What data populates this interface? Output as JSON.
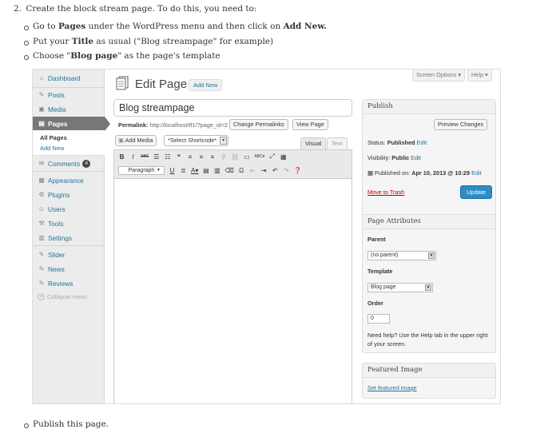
{
  "doc": {
    "step_number": "2.",
    "step_text": "Create the block stream page. To do this, you need to:",
    "bullets": [
      {
        "pre": "Go to ",
        "bold1": "Pages",
        "mid": " under the WordPress menu and then click on ",
        "bold2": "Add New.",
        "post": ""
      },
      {
        "pre": "Put your ",
        "bold1": "Title",
        "mid": " as usual (\"Blog streampage\" for example)",
        "bold2": "",
        "post": ""
      },
      {
        "pre": "Choose \"",
        "bold1": "Blog page",
        "mid": "\" as the page's template",
        "bold2": "",
        "post": ""
      }
    ],
    "final_bullet": "Publish this page."
  },
  "admin_menu": {
    "items": [
      {
        "label": "Dashboard",
        "icon": "dashboard-icon",
        "glyph": "⌂"
      },
      {
        "label": "Posts",
        "icon": "pin-icon",
        "glyph": "✎"
      },
      {
        "label": "Media",
        "icon": "media-icon",
        "glyph": "▣"
      },
      {
        "label": "Pages",
        "icon": "pages-icon",
        "glyph": "▤"
      },
      {
        "label": "Comments",
        "icon": "comments-icon",
        "glyph": "✉",
        "badge": "4"
      },
      {
        "label": "Appearance",
        "icon": "appearance-icon",
        "glyph": "▦"
      },
      {
        "label": "Plugins",
        "icon": "plugins-icon",
        "glyph": "⚙"
      },
      {
        "label": "Users",
        "icon": "users-icon",
        "glyph": "☺"
      },
      {
        "label": "Tools",
        "icon": "tools-icon",
        "glyph": "⚒"
      },
      {
        "label": "Settings",
        "icon": "settings-icon",
        "glyph": "▥"
      },
      {
        "label": "Slider",
        "icon": "pin-icon",
        "glyph": "✎"
      },
      {
        "label": "News",
        "icon": "pin-icon",
        "glyph": "✎"
      },
      {
        "label": "Reviews",
        "icon": "pin-icon",
        "glyph": "✎"
      }
    ],
    "submenu": {
      "all_pages": "All Pages",
      "add_new": "Add New"
    },
    "collapse": "Collapse menu"
  },
  "top_tabs": {
    "screen_options": "Screen Options ▾",
    "help": "Help ▾"
  },
  "header": {
    "title": "Edit Page",
    "add_new": "Add New"
  },
  "title_field": {
    "value": "Blog streampage"
  },
  "permalink": {
    "label": "Permalink:",
    "url": "http://localhost/tf1/?page_id=2",
    "change_btn": "Change Permalinks",
    "view_btn": "View Page"
  },
  "media": {
    "add_media": "Add Media",
    "shortcode": "*Select Shortcode*"
  },
  "editor_tabs": {
    "visual": "Visual",
    "text": "Text"
  },
  "toolbar": {
    "row1": [
      "B",
      "I",
      "ABC",
      "☰",
      "☷",
      "❝",
      "≡",
      "≡",
      "≡",
      "⚲",
      "⛓",
      "▭",
      "ABC▾",
      "⤢",
      "▦"
    ],
    "format": "Paragraph",
    "row2": [
      "U",
      "≣",
      "A▾",
      "▤",
      "▥",
      "⌫",
      "Ω",
      "⇤",
      "⇥",
      "↶",
      "↷",
      "❓"
    ]
  },
  "publish_box": {
    "title": "Publish",
    "preview": "Preview Changes",
    "status_label": "Status:",
    "status_value": "Published",
    "visibility_label": "Visibility:",
    "visibility_value": "Public",
    "published_label": "Published on:",
    "published_value": "Apr 10, 2013 @ 10:29",
    "edit": "Edit",
    "trash": "Move to Trash",
    "update": "Update"
  },
  "attributes_box": {
    "title": "Page Attributes",
    "parent_label": "Parent",
    "parent_value": "(no parent)",
    "template_label": "Template",
    "template_value": "Blog page",
    "order_label": "Order",
    "order_value": "0",
    "help": "Need help? Use the Help tab in the upper right of your screen."
  },
  "featured_box": {
    "title": "Featured Image",
    "link": "Set featured image"
  },
  "colors": {
    "link": "#21759b",
    "active_menu": "#777777",
    "update_btn": "#2e8cc5",
    "trash": "#bb0000"
  }
}
